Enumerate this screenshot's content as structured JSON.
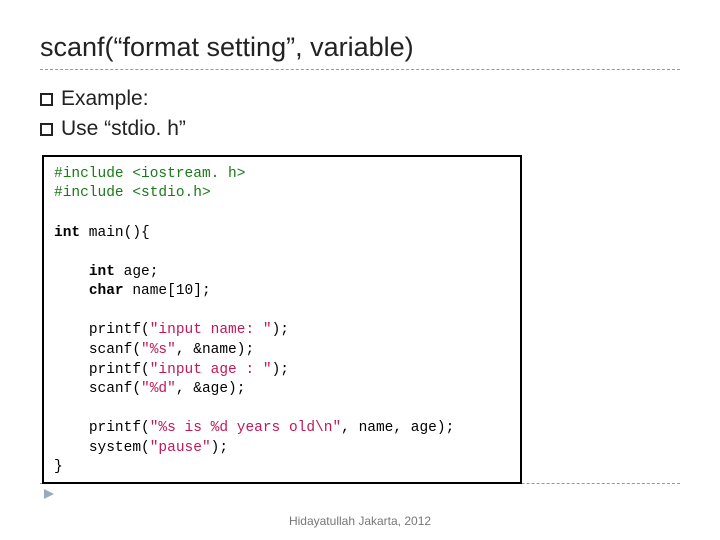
{
  "title": "scanf(“format setting”, variable)",
  "bullets": [
    "Example:",
    "Use “stdio. h”"
  ],
  "code": {
    "l1a": "#include ",
    "l1b": "<iostream. h>",
    "l2a": "#include ",
    "l2b": "<stdio.h>",
    "l3": "",
    "l4_kw": "int",
    "l4_rest": " main(){",
    "l5": "",
    "l6_sp": "    ",
    "l6_kw": "int",
    "l6_rest": " age;",
    "l7_sp": "    ",
    "l7_kw": "char",
    "l7_rest": " name[10];",
    "l8": "",
    "l9_sp": "    ",
    "l9a": "printf(",
    "l9s": "\"input name: \"",
    "l9b": ");",
    "l10_sp": "    ",
    "l10a": "scanf(",
    "l10s": "\"%s\"",
    "l10b": ", &name);",
    "l11_sp": "    ",
    "l11a": "printf(",
    "l11s": "\"input age : \"",
    "l11b": ");",
    "l12_sp": "    ",
    "l12a": "scanf(",
    "l12s": "\"%d\"",
    "l12b": ", &age);",
    "l13": "",
    "l14_sp": "    ",
    "l14a": "printf(",
    "l14s": "\"%s is %d years old\\n\"",
    "l14b": ", name, age);",
    "l15_sp": "    ",
    "l15a": "system(",
    "l15s": "\"pause\"",
    "l15b": ");",
    "l16": "}"
  },
  "footer": "Hidayatullah Jakarta, 2012"
}
